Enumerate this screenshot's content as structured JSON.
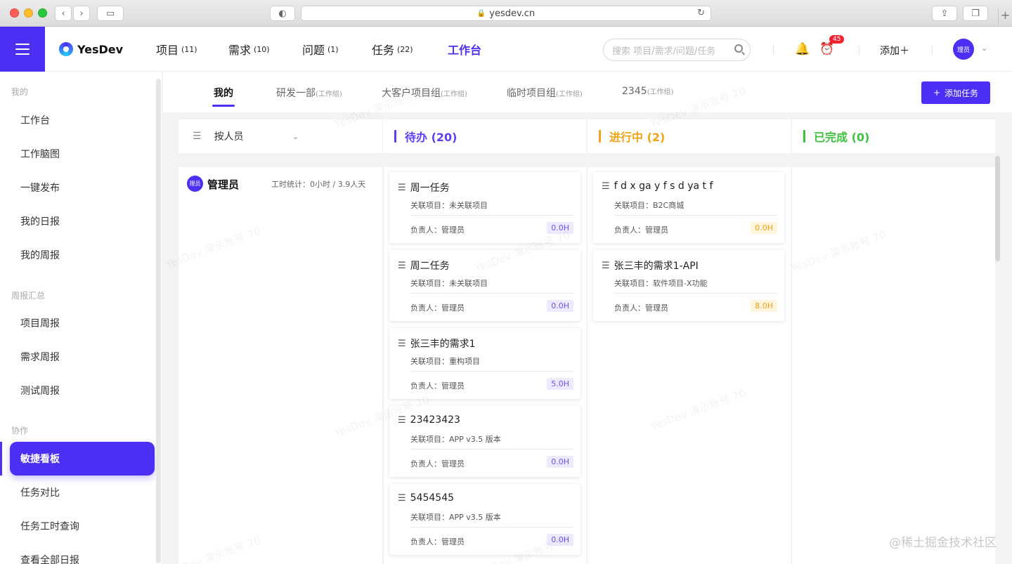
{
  "browser": {
    "url": "yesdev.cn"
  },
  "header": {
    "logo_text": "YesDev",
    "nav": [
      {
        "label": "项目",
        "count": "(11)"
      },
      {
        "label": "需求",
        "count": "(10)"
      },
      {
        "label": "问题",
        "count": "(1)"
      },
      {
        "label": "任务",
        "count": "(22)"
      },
      {
        "label": "工作台",
        "count": ""
      }
    ],
    "search_placeholder": "搜索 项目/需求/问题/任务",
    "alarm_badge": "45",
    "add_label": "添加＋",
    "avatar_text": "理员"
  },
  "sidebar": {
    "groups": [
      "我的",
      "周报汇总",
      "协作"
    ],
    "items": [
      "工作台",
      "工作脑图",
      "一键发布",
      "我的日报",
      "我的周报",
      "项目周报",
      "需求周报",
      "测试周报",
      "敏捷看板",
      "任务对比",
      "任务工时查询",
      "查看全部日报"
    ],
    "active_item": "敏捷看板"
  },
  "tabs": [
    {
      "label": "我的",
      "tag": ""
    },
    {
      "label": "研发一部",
      "tag": "(工作组)"
    },
    {
      "label": "大客户项目组",
      "tag": "(工作组)"
    },
    {
      "label": "临时项目组",
      "tag": "(工作组)"
    },
    {
      "label": "2345",
      "tag": "(工作组)"
    }
  ],
  "add_task_label": "添加任务",
  "group_by": "按人员",
  "columns": [
    {
      "title": "待办 (20)",
      "color": "#5b3ff3"
    },
    {
      "title": "进行中 (2)",
      "color": "#f2a316"
    },
    {
      "title": "已完成 (0)",
      "color": "#3cc33c"
    }
  ],
  "user": {
    "avatar_text": "理员",
    "name": "管理员",
    "stats": "工时统计：0小时 / 3.9人天"
  },
  "todo_cards": [
    {
      "title": "周一任务",
      "project": "关联项目：未关联项目",
      "owner": "负责人：管理员",
      "hours": "0.0H"
    },
    {
      "title": "周二任务",
      "project": "关联项目：未关联项目",
      "owner": "负责人：管理员",
      "hours": "0.0H"
    },
    {
      "title": "张三丰的需求1",
      "project": "关联项目：重构项目",
      "owner": "负责人：管理员",
      "hours": "5.0H"
    },
    {
      "title": "23423423",
      "project": "关联项目：APP v3.5 版本",
      "owner": "负责人：管理员",
      "hours": "0.0H"
    },
    {
      "title": "5454545",
      "project": "关联项目：APP v3.5 版本",
      "owner": "负责人：管理员",
      "hours": "0.0H"
    }
  ],
  "doing_cards": [
    {
      "title": "f d x ga y f s d ya t f",
      "project": "关联项目：B2C商城",
      "owner": "负责人：管理员",
      "hours": "0.0H"
    },
    {
      "title": "张三丰的需求1-API",
      "project": "关联项目：软件项目-X功能",
      "owner": "负责人：管理员",
      "hours": "8.0H"
    }
  ],
  "watermark_text": "YesDev 演示账号 70",
  "footer_mark": "@稀土掘金技术社区"
}
